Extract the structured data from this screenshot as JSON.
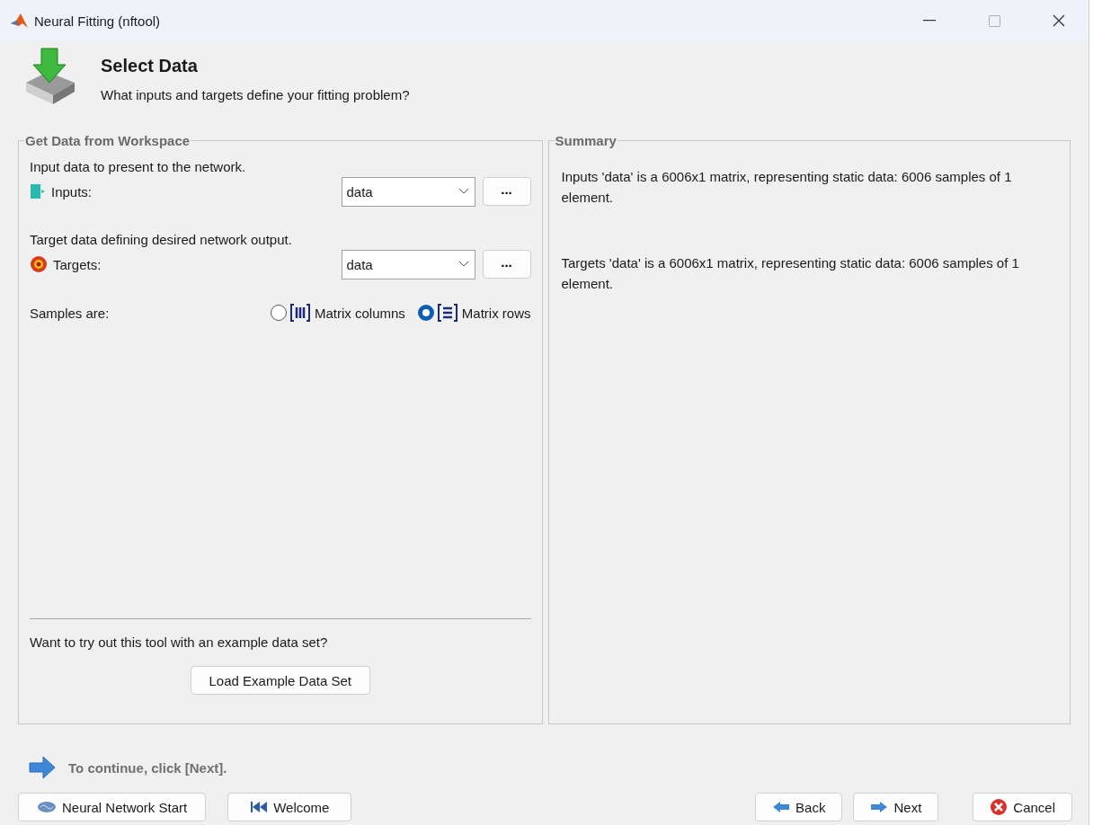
{
  "window": {
    "title": "Neural Fitting (nftool)"
  },
  "header": {
    "title": "Select Data",
    "subtitle": "What inputs and targets define your fitting problem?"
  },
  "data_panel": {
    "title": "Get Data from Workspace",
    "fields": [
      {
        "kind": "inputs",
        "description": "Input data to present to the network.",
        "label": "Inputs:",
        "value": "data",
        "browse": "..."
      },
      {
        "kind": "targets",
        "description": "Target data defining desired network output.",
        "label": "Targets:",
        "value": "data",
        "browse": "..."
      }
    ],
    "samples": {
      "label": "Samples are:",
      "options": [
        {
          "kind": "columns",
          "label": "Matrix columns",
          "selected": false
        },
        {
          "kind": "rows",
          "label": "Matrix rows",
          "selected": true
        }
      ]
    },
    "example": {
      "text": "Want to try out this tool with an example data set?",
      "button": "Load Example Data Set"
    }
  },
  "summary": {
    "title": "Summary",
    "paragraphs": [
      "Inputs 'data' is a 6006x1 matrix, representing static data: 6006 samples of 1 element.",
      "Targets 'data' is a 6006x1 matrix, representing static data: 6006 samples of 1 element."
    ]
  },
  "hint": "To continue, click [Next].",
  "nav_left": [
    {
      "kind": "start",
      "label": "Neural Network Start"
    },
    {
      "kind": "welcome",
      "label": "Welcome"
    }
  ],
  "nav_right": [
    {
      "kind": "back",
      "label": "Back"
    },
    {
      "kind": "next",
      "label": "Next"
    },
    {
      "kind": "cancel",
      "label": "Cancel"
    }
  ]
}
